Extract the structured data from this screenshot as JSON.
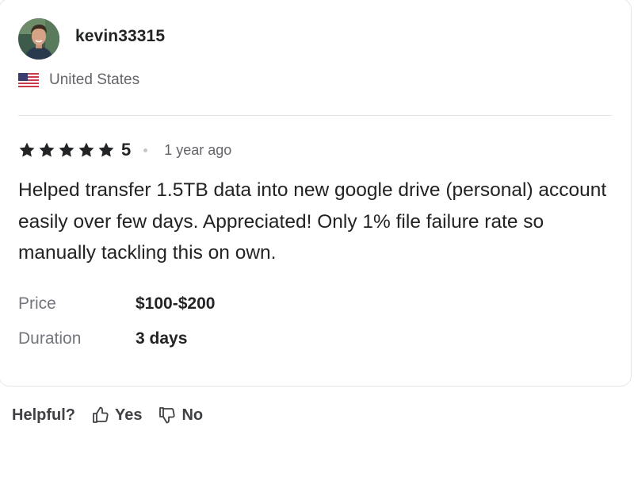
{
  "review": {
    "username": "kevin33315",
    "country": "United States",
    "rating": {
      "stars": 5,
      "value_label": "5"
    },
    "date": "1 year ago",
    "text": "Helped transfer 1.5TB data into new google drive (personal) account easily over few days. Appreciated! Only 1% file failure rate so manually tackling this on own.",
    "details": {
      "price_label": "Price",
      "price_value": "$100-$200",
      "duration_label": "Duration",
      "duration_value": "3 days"
    }
  },
  "feedback": {
    "question": "Helpful?",
    "yes_label": "Yes",
    "no_label": "No"
  },
  "icons": {
    "avatar": "avatar",
    "flag": "us-flag-icon",
    "star": "star-icon",
    "thumbs_up": "thumbs-up-icon",
    "thumbs_down": "thumbs-down-icon"
  },
  "colors": {
    "text_primary": "#222325",
    "text_secondary": "#62646a",
    "divider": "#e4e5e7"
  }
}
